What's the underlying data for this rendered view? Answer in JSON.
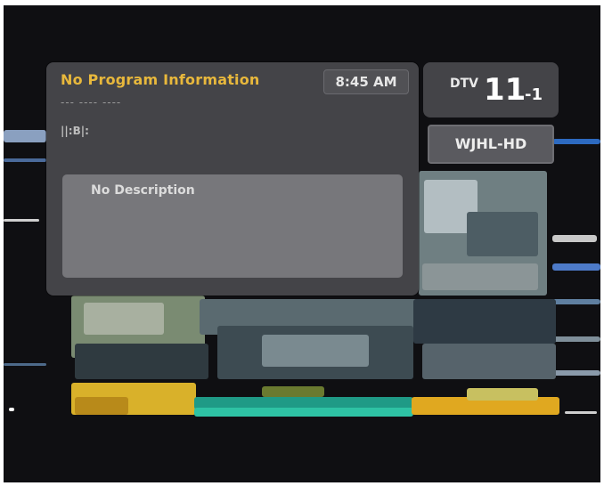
{
  "info_panel": {
    "program_title": "No Program Information",
    "time": "8:45 AM",
    "program_dashes": "--- ---- ----",
    "rating_label": "||:B|:",
    "description": "No Description"
  },
  "channel_panel": {
    "network_label": "DTV",
    "channel_major": "11",
    "channel_minor": "-1",
    "callsign": "WJHL-HD"
  },
  "colors": {
    "title_accent": "#e8b83c",
    "panel_background": "#48484c",
    "description_background": "#77777b"
  }
}
